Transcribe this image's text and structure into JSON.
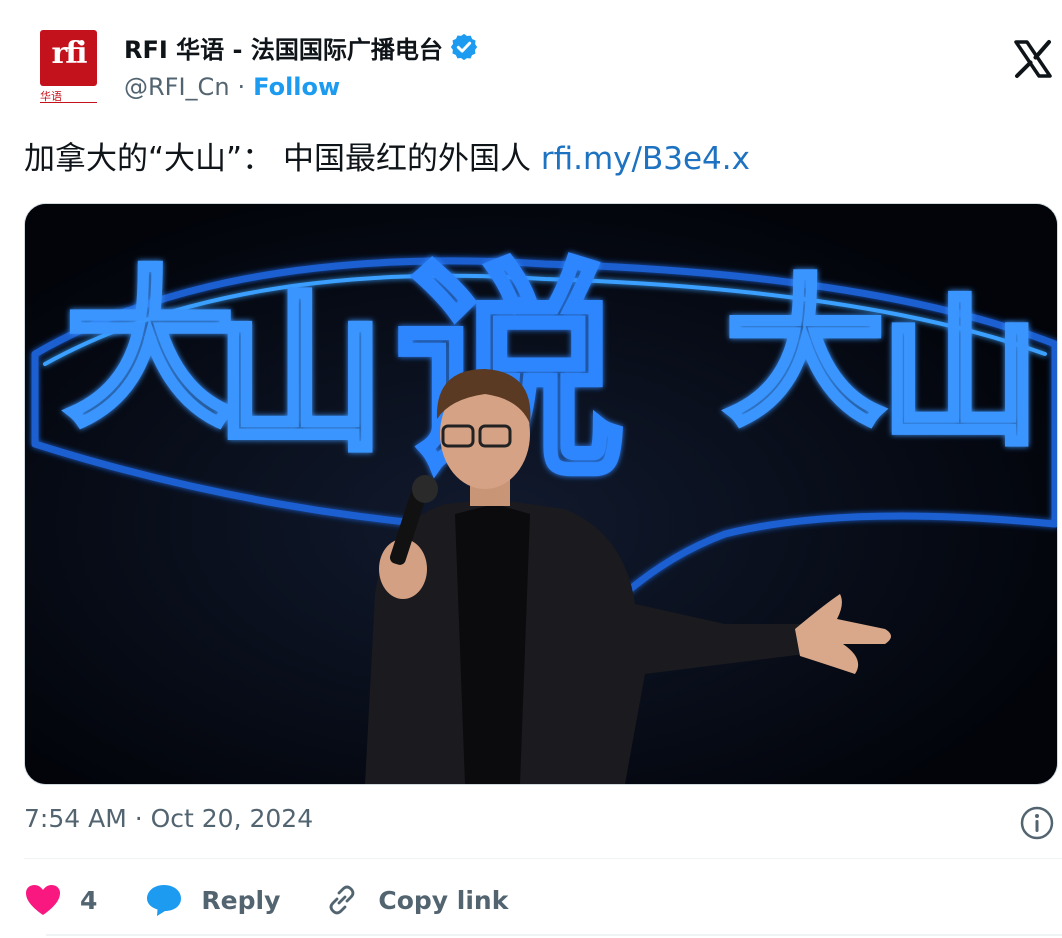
{
  "author": {
    "avatar_text": "rfi",
    "avatar_subtext": "华语",
    "display_name": "RFI 华语 - 法国国际广播电台",
    "handle": "@RFI_Cn",
    "separator": "·",
    "follow_label": "Follow",
    "verified": true
  },
  "tweet": {
    "text": "加拿大的“大山”： 中国最红的外国人",
    "link": "rfi.my/B3e4.x"
  },
  "media": {
    "neon_text": [
      "大",
      "山",
      "说",
      "大",
      "山"
    ]
  },
  "meta": {
    "timestamp": "7:54 AM · Oct 20, 2024"
  },
  "actions": {
    "like_count": "4",
    "reply_label": "Reply",
    "copy_label": "Copy link"
  },
  "colors": {
    "accent": "#1d9bf0",
    "link": "#1d72c2",
    "like": "#f91880",
    "brand": "#c4121c",
    "neon": "#2b8fff"
  },
  "icons": {
    "close": "x-logo-icon",
    "verified": "verified-badge-icon",
    "info": "info-icon",
    "like": "heart-icon",
    "reply": "speech-bubble-icon",
    "copy": "link-icon"
  }
}
